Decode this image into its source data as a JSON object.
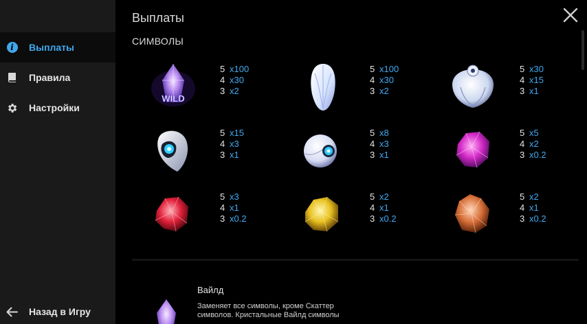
{
  "sidebar": {
    "items": [
      {
        "label": "Выплаты",
        "icon": "info-icon",
        "active": true
      },
      {
        "label": "Правила",
        "icon": "book-icon",
        "active": false
      },
      {
        "label": "Настройки",
        "icon": "gear-icon",
        "active": false
      }
    ],
    "back_label": "Назад в Игру"
  },
  "main": {
    "title": "Выплаты",
    "section": "СИМВОЛЫ",
    "close_icon": "close-icon"
  },
  "colors": {
    "accent": "#41a8ee",
    "sidebar_bg": "#1a1a1a",
    "page_bg": "#000000"
  },
  "paytable": [
    {
      "symbol": "wild-crystal",
      "wild_label": "WILD",
      "pays": [
        {
          "count": "5",
          "mult": "x100"
        },
        {
          "count": "4",
          "mult": "x30"
        },
        {
          "count": "3",
          "mult": "x2"
        }
      ]
    },
    {
      "symbol": "white-pod",
      "pays": [
        {
          "count": "5",
          "mult": "x100"
        },
        {
          "count": "4",
          "mult": "x30"
        },
        {
          "count": "3",
          "mult": "x2"
        }
      ]
    },
    {
      "symbol": "white-robot",
      "pays": [
        {
          "count": "5",
          "mult": "x30"
        },
        {
          "count": "4",
          "mult": "x15"
        },
        {
          "count": "3",
          "mult": "x1"
        }
      ]
    },
    {
      "symbol": "robot-head",
      "pays": [
        {
          "count": "5",
          "mult": "x15"
        },
        {
          "count": "4",
          "mult": "x3"
        },
        {
          "count": "3",
          "mult": "x1"
        }
      ]
    },
    {
      "symbol": "white-orb",
      "pays": [
        {
          "count": "5",
          "mult": "x8"
        },
        {
          "count": "4",
          "mult": "x3"
        },
        {
          "count": "3",
          "mult": "x1"
        }
      ]
    },
    {
      "symbol": "pink-crystal",
      "pays": [
        {
          "count": "5",
          "mult": "x5"
        },
        {
          "count": "4",
          "mult": "x2"
        },
        {
          "count": "3",
          "mult": "x0.2"
        }
      ]
    },
    {
      "symbol": "red-crystal",
      "pays": [
        {
          "count": "5",
          "mult": "x3"
        },
        {
          "count": "4",
          "mult": "x1"
        },
        {
          "count": "3",
          "mult": "x0.2"
        }
      ]
    },
    {
      "symbol": "yellow-crystal",
      "pays": [
        {
          "count": "5",
          "mult": "x2"
        },
        {
          "count": "4",
          "mult": "x1"
        },
        {
          "count": "3",
          "mult": "x0.2"
        }
      ]
    },
    {
      "symbol": "orange-crystal",
      "pays": [
        {
          "count": "5",
          "mult": "x2"
        },
        {
          "count": "4",
          "mult": "x1"
        },
        {
          "count": "3",
          "mult": "x0.2"
        }
      ]
    }
  ],
  "wild": {
    "title": "Вайлд",
    "description": "Заменяет все символы, кроме Скаттер символов. Кристальные Вайлд символы"
  }
}
